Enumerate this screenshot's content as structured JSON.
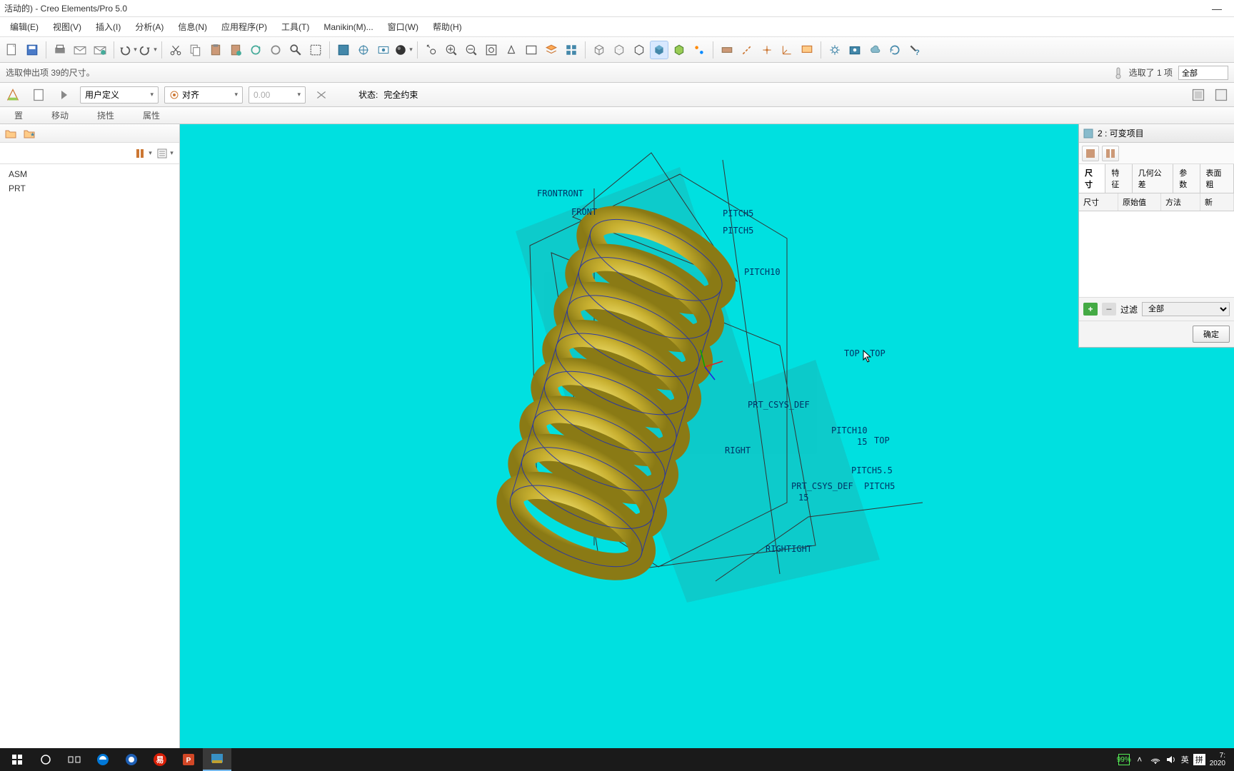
{
  "title": "活动的) - Creo Elements/Pro 5.0",
  "menu": {
    "edit": "编辑(E)",
    "view": "视图(V)",
    "insert": "插入(I)",
    "analyze": "分析(A)",
    "info": "信息(N)",
    "app": "应用程序(P)",
    "tools": "工具(T)",
    "manikin": "Manikin(M)...",
    "window": "窗口(W)",
    "help": "帮助(H)"
  },
  "status": {
    "message": "选取伸出项 39的尺寸。",
    "selected": "选取了 1 项",
    "filter": "全部"
  },
  "constraint": {
    "userdef": "用户定义",
    "align": "对齐",
    "value": "0.00",
    "state_label": "状态:",
    "state_val": "完全约束"
  },
  "tabs": {
    "place": "置",
    "move": "移动",
    "flex": "挠性",
    "prop": "属性"
  },
  "tree": {
    "asm": "ASM",
    "prt": "PRT"
  },
  "rightpanel": {
    "title": "2 : 可变项目",
    "tab_dim": "尺寸",
    "tab_feat": "特征",
    "tab_geotol": "几何公差",
    "tab_param": "参数",
    "tab_surf": "表面粗",
    "col_dim": "尺寸",
    "col_orig": "原始值",
    "col_method": "方法",
    "col_new": "新",
    "filter_label": "过滤",
    "filter_val": "全部",
    "ok": "确定"
  },
  "viewport": {
    "labels": {
      "frontront": "FRONTRONT",
      "front": "FRONT",
      "pitch5a": "PITCH5",
      "pitch5b": "PITCH5",
      "pitch10a": "PITCH10",
      "top1": "TOP",
      "top2": "TOP",
      "prt_csys": "PRT_CSYS_DEF",
      "pitch10b": "PITCH10",
      "num15": "15",
      "top3": "TOP",
      "pitch5c": "PITCH5.5",
      "pitch5d": "PITCH5",
      "prt_csys2": "PRT_CSYS_DEF",
      "num15b": "15",
      "right": "RIGHT",
      "rightight": "RIGHTIGHT"
    }
  },
  "taskbar": {
    "battery": "99%",
    "ime1": "英",
    "ime2": "拼",
    "time": "7:",
    "date": "2020"
  }
}
